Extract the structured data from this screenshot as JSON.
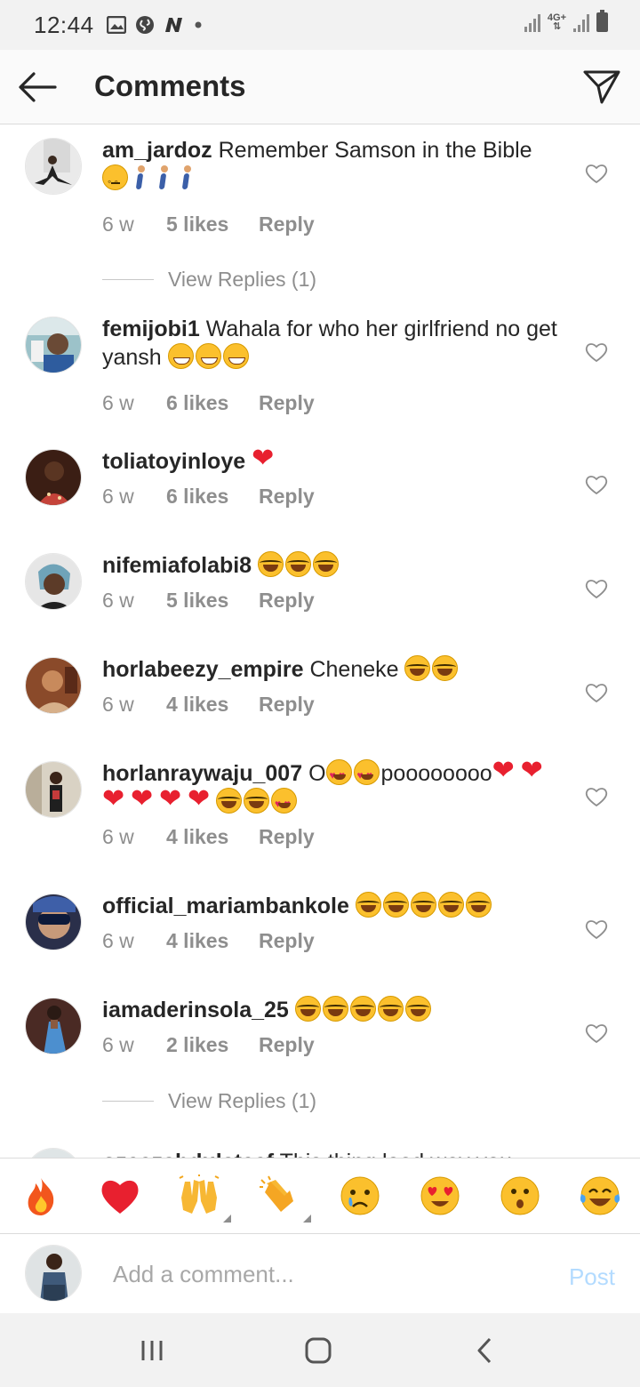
{
  "status_bar": {
    "time": "12:44",
    "network": "4G+"
  },
  "header": {
    "title": "Comments"
  },
  "comments": [
    {
      "username": "am_jardoz",
      "text": "Remember Samson in the Bible",
      "emoji": [
        "face-with-rolling-eyes",
        "person-walking",
        "person-walking",
        "person-walking"
      ],
      "time": "6 w",
      "likes": "5 likes",
      "reply": "Reply",
      "view_replies": "View Replies (1)"
    },
    {
      "username": "femijobi1",
      "text": "Wahala for who her girlfriend no get yansh",
      "emoji": [
        "grinning-face",
        "grinning-face",
        "grinning-face"
      ],
      "time": "6 w",
      "likes": "6 likes",
      "reply": "Reply"
    },
    {
      "username": "toliatoyinloye",
      "text": "",
      "emoji": [
        "red-heart"
      ],
      "time": "6 w",
      "likes": "6 likes",
      "reply": "Reply"
    },
    {
      "username": "nifemiafolabi8",
      "text": "",
      "emoji": [
        "tears-of-joy",
        "tears-of-joy",
        "tears-of-joy"
      ],
      "time": "6 w",
      "likes": "5 likes",
      "reply": "Reply"
    },
    {
      "username": "horlabeezy_empire",
      "text": "Cheneke",
      "emoji": [
        "tears-of-joy",
        "tears-of-joy"
      ],
      "time": "6 w",
      "likes": "4 likes",
      "reply": "Reply"
    },
    {
      "username": "horlanraywaju_007",
      "text_a": "O",
      "text_b": "poooooooo",
      "time": "6 w",
      "likes": "4 likes",
      "reply": "Reply"
    },
    {
      "username": "official_mariambankole",
      "text": "",
      "emoji": [
        "tears-of-joy",
        "tears-of-joy",
        "tears-of-joy",
        "tears-of-joy",
        "tears-of-joy"
      ],
      "time": "6 w",
      "likes": "4 likes",
      "reply": "Reply"
    },
    {
      "username": "iamaderinsola_25",
      "text": "",
      "emoji": [
        "tears-of-joy",
        "tears-of-joy",
        "tears-of-joy",
        "tears-of-joy",
        "tears-of-joy"
      ],
      "time": "6 w",
      "likes": "2 likes",
      "reply": "Reply",
      "view_replies": "View Replies (1)"
    },
    {
      "username": "ozeezabdulateef",
      "text": "This thing load way you",
      "partial": true
    }
  ],
  "reactions": [
    "fire",
    "red-heart",
    "raising-hands",
    "clapping-hands",
    "crying-face",
    "heart-eyes",
    "hushed-face",
    "tears-of-joy"
  ],
  "compose": {
    "placeholder": "Add a comment...",
    "post_label": "Post"
  },
  "colors": {
    "text": "#262626",
    "secondary": "#8e8e8e",
    "post_disabled": "#b3dbff",
    "heart": "#e8202f"
  }
}
